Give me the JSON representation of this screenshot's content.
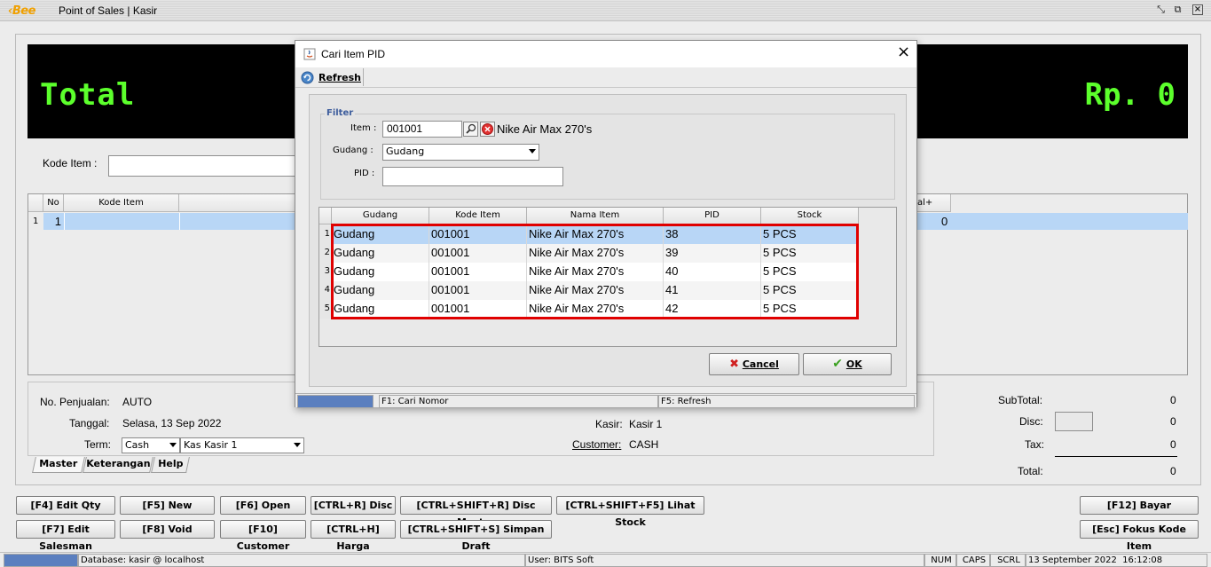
{
  "app": {
    "logo": "Bee",
    "title": "Point of Sales | Kasir"
  },
  "display": {
    "label": "Total",
    "amount": "Rp. 0"
  },
  "kode_item": {
    "label": "Kode Item :",
    "value": ""
  },
  "main_table": {
    "headers": [
      "No",
      "Kode Item"
    ],
    "tail_header": "al+",
    "rows": [
      {
        "rownum": "1",
        "no": "1",
        "total": "0"
      }
    ]
  },
  "info": {
    "no_penjualan_label": "No. Penjualan:",
    "no_penjualan": "AUTO",
    "tanggal_label": "Tanggal:",
    "tanggal": "Selasa, 13 Sep 2022",
    "term_label": "Term:",
    "term": "Cash",
    "kas": "Kas Kasir 1",
    "kasir_label": "Kasir:",
    "kasir": "Kasir 1",
    "customer_label": "Customer:",
    "customer": "CASH"
  },
  "tabs": [
    "Master",
    "Keterangan",
    "Help"
  ],
  "totals": {
    "subtotal_label": "SubTotal:",
    "subtotal": "0",
    "disc_label": "Disc:",
    "disc": "0",
    "tax_label": "Tax:",
    "tax": "0",
    "total_label": "Total:",
    "total": "0"
  },
  "buttons_row1": [
    "[F4] Edit Qty",
    "[F5] New",
    "[F6] Open",
    "[CTRL+R] Disc",
    "[CTRL+SHIFT+R] Disc Master",
    "[CTRL+SHIFT+F5] Lihat Stock"
  ],
  "buttons_row2": [
    "[F7] Edit Salesman",
    "[F8] Void",
    "[F10] Customer",
    "[CTRL+H] Harga",
    "[CTRL+SHIFT+S] Simpan Draft"
  ],
  "btn_bayar": "[F12] Bayar",
  "btn_fokus": "[Esc] Fokus Kode Item",
  "status": {
    "database": "Database: kasir @ localhost",
    "user": "User: BITS Soft",
    "num": "NUM",
    "caps": "CAPS",
    "scrl": "SCRL",
    "datetime": "13 September 2022  16:12:08"
  },
  "dialog": {
    "title": "Cari Item PID",
    "refresh": "Refresh",
    "filter_legend": "Filter",
    "item_label": "Item :",
    "item_value": "001001",
    "item_name": "Nike Air Max 270's",
    "gudang_label": "Gudang :",
    "gudang_value": "Gudang",
    "pid_label": "PID :",
    "pid_value": "",
    "grid_headers": [
      "Gudang",
      "Kode Item",
      "Nama Item",
      "PID",
      "Stock"
    ],
    "rows": [
      {
        "n": "1",
        "gudang": "Gudang",
        "kode": "001001",
        "nama": "Nike Air Max 270's",
        "pid": "38",
        "stock": "5 PCS"
      },
      {
        "n": "2",
        "gudang": "Gudang",
        "kode": "001001",
        "nama": "Nike Air Max 270's",
        "pid": "39",
        "stock": "5 PCS"
      },
      {
        "n": "3",
        "gudang": "Gudang",
        "kode": "001001",
        "nama": "Nike Air Max 270's",
        "pid": "40",
        "stock": "5 PCS"
      },
      {
        "n": "4",
        "gudang": "Gudang",
        "kode": "001001",
        "nama": "Nike Air Max 270's",
        "pid": "41",
        "stock": "5 PCS"
      },
      {
        "n": "5",
        "gudang": "Gudang",
        "kode": "001001",
        "nama": "Nike Air Max 270's",
        "pid": "42",
        "stock": "5 PCS"
      }
    ],
    "cancel": "Cancel",
    "ok": "OK",
    "status_f1": "F1: Cari Nomor",
    "status_f5": "F5: Refresh"
  },
  "colors": {
    "display_bg": "#000000",
    "display_fg": "#5cff2c",
    "selection": "#b8d6f6",
    "highlight_border": "#e00000",
    "accent_blue": "#5b7fbf"
  }
}
